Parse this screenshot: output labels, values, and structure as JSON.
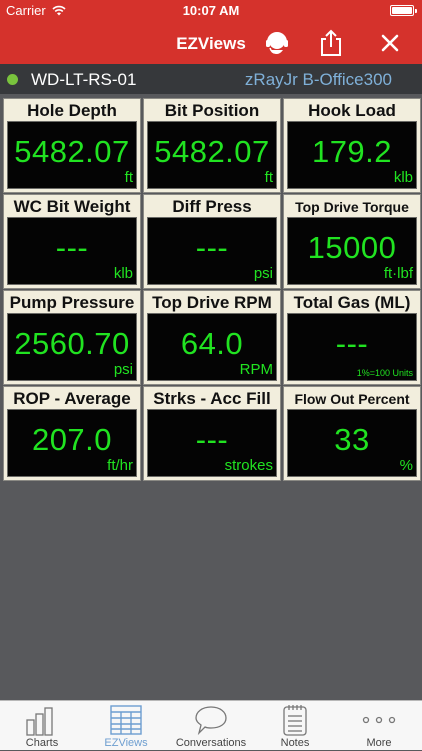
{
  "status_bar": {
    "carrier": "Carrier",
    "time": "10:07 AM",
    "battery_level": 1.0
  },
  "nav": {
    "title": "EZViews",
    "icons": [
      "headset-icon",
      "share-icon",
      "close-icon"
    ]
  },
  "well_header": {
    "well_name": "WD-LT-RS-01",
    "server": "zRayJr B-Office300",
    "status_color": "#79c33d"
  },
  "tiles": [
    {
      "label": "Hole Depth",
      "value": "5482.07",
      "unit": "ft"
    },
    {
      "label": "Bit Position",
      "value": "5482.07",
      "unit": "ft"
    },
    {
      "label": "Hook Load",
      "value": "179.2",
      "unit": "klb"
    },
    {
      "label": "WC Bit Weight",
      "value": "---",
      "unit": "klb"
    },
    {
      "label": "Diff Press",
      "value": "---",
      "unit": "psi"
    },
    {
      "label": "Top Drive Torque",
      "value": "15000",
      "unit": "ft·lbf"
    },
    {
      "label": "Pump Pressure",
      "value": "2560.70",
      "unit": "psi"
    },
    {
      "label": "Top Drive RPM",
      "value": "64.0",
      "unit": "RPM"
    },
    {
      "label": "Total Gas (ML)",
      "value": "---",
      "unit": "1%=100 Units"
    },
    {
      "label": "ROP - Average",
      "value": "207.0",
      "unit": "ft/hr"
    },
    {
      "label": "Strks - Acc Fill",
      "value": "---",
      "unit": "strokes"
    },
    {
      "label": "Flow Out Percent",
      "value": "33",
      "unit": "%"
    }
  ],
  "tab_bar": {
    "tabs": [
      {
        "label": "Charts",
        "icon": "bar-chart-icon"
      },
      {
        "label": "EZViews",
        "icon": "grid-icon"
      },
      {
        "label": "Conversations",
        "icon": "speech-bubble-icon"
      },
      {
        "label": "Notes",
        "icon": "notepad-icon"
      },
      {
        "label": "More",
        "icon": "ellipsis-icon"
      }
    ],
    "active": "EZViews"
  },
  "colors": {
    "nav_red": "#d5322c",
    "digit_green": "#21e321",
    "tile_bg": "#f2eedd",
    "page_bg": "#58595c",
    "tab_active": "#6d9ed0"
  }
}
